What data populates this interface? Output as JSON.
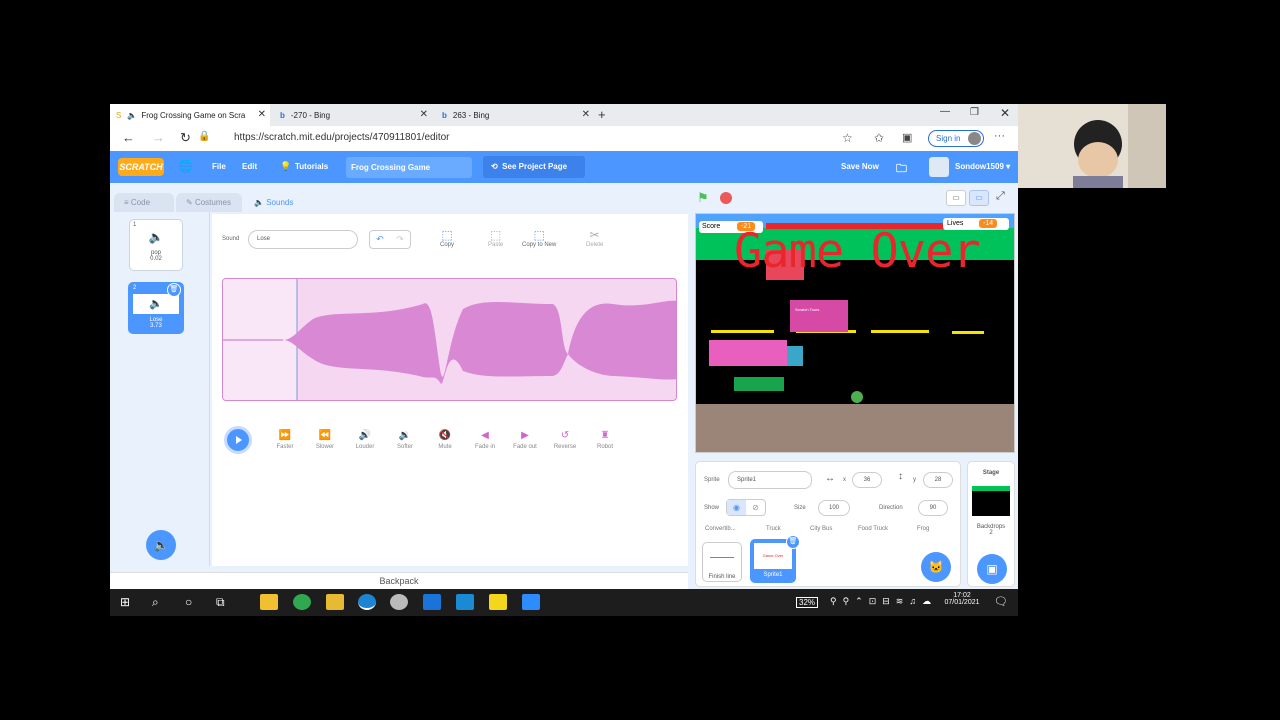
{
  "browser": {
    "tabs": [
      {
        "label": "Frog Crossing Game on Scra",
        "active": true
      },
      {
        "label": "-270 - Bing",
        "active": false
      },
      {
        "label": "263 - Bing",
        "active": false
      }
    ],
    "new_tab": "+",
    "url": "https://scratch.mit.edu/projects/470911801/editor",
    "sign_in": "Sign in",
    "more": "···"
  },
  "menu": {
    "logo": "SCRATCH",
    "file": "File",
    "edit": "Edit",
    "tutorials": "Tutorials",
    "project_title": "Frog Crossing Game",
    "see_project": "See Project Page",
    "save_now": "Save Now",
    "username": "Sondow1509"
  },
  "editor_tabs": {
    "code": "Code",
    "costumes": "Costumes",
    "sounds": "Sounds"
  },
  "sounds": [
    {
      "index": "1",
      "name": "pop",
      "duration": "0.02"
    },
    {
      "index": "2",
      "name": "Lose",
      "duration": "3.73"
    }
  ],
  "sound_editor": {
    "sound_label": "Sound",
    "sound_name": "Lose",
    "copy": "Copy",
    "paste": "Paste",
    "copy_to_new": "Copy to New",
    "delete": "Delete",
    "effects": [
      "Faster",
      "Slower",
      "Louder",
      "Softer",
      "Mute",
      "Fade in",
      "Fade out",
      "Reverse",
      "Robot"
    ]
  },
  "backpack": "Backpack",
  "stage": {
    "score_label": "Score",
    "score_value": "-21",
    "lives_label": "Lives",
    "lives_value": "-14",
    "game_over": "Game Over",
    "bus_text": "Scratch Tours"
  },
  "sprite_info": {
    "sprite_label": "Sprite",
    "sprite_name": "Sprite1",
    "x_label": "x",
    "x_value": "36",
    "y_label": "y",
    "y_value": "28",
    "show_label": "Show",
    "size_label": "Size",
    "size_value": "100",
    "direction_label": "Direction",
    "direction_value": "90",
    "sprites_row": [
      "Convertib...",
      "Truck",
      "City Bus",
      "Food Truck",
      "Frog"
    ],
    "sprites": [
      {
        "name": "Finish line",
        "selected": false
      },
      {
        "name": "Sprite1",
        "selected": true
      }
    ]
  },
  "stage_panel": {
    "title": "Stage",
    "backdrops": "Backdrops",
    "count": "2"
  },
  "taskbar": {
    "battery": "32%",
    "time": "17:02",
    "date": "07/01/2021"
  }
}
